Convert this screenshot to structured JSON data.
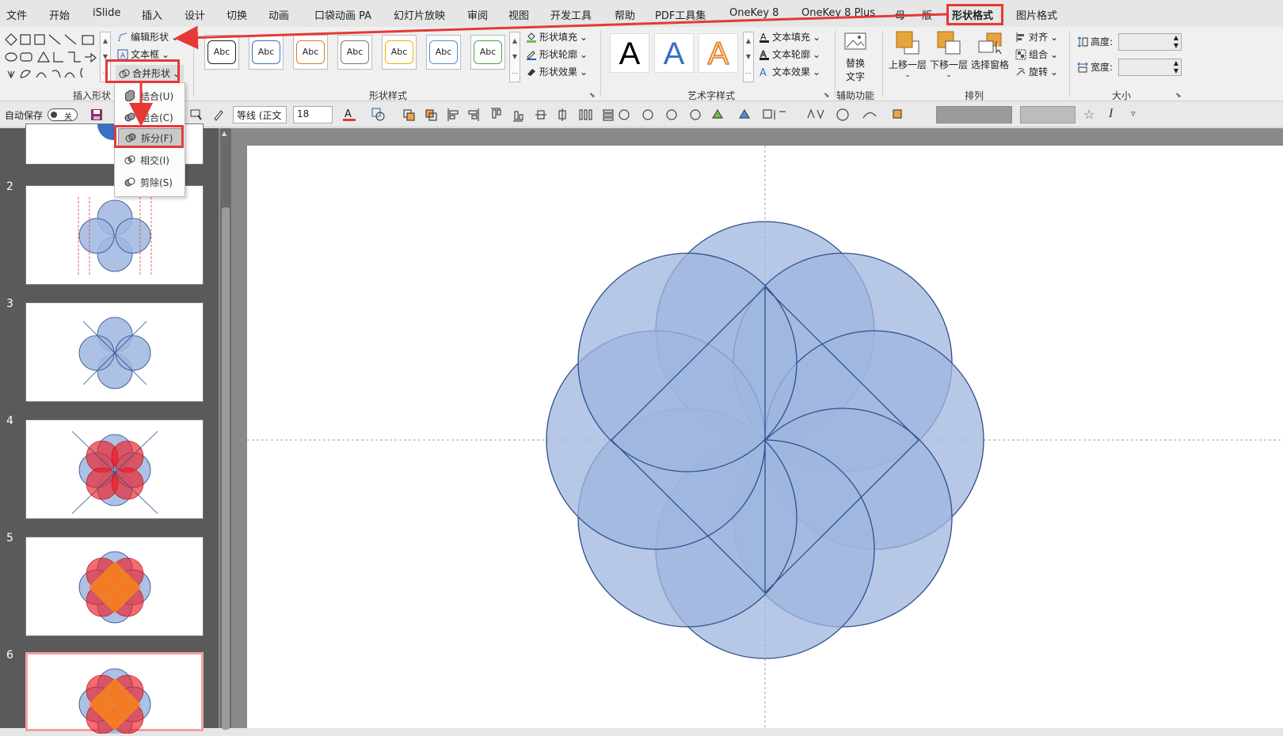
{
  "menubar": {
    "tabs": [
      "文件",
      "开始",
      "iSlide",
      "插入",
      "设计",
      "切换",
      "动画",
      "口袋动画 PA",
      "幻灯片放映",
      "审阅",
      "视图",
      "开发工具",
      "帮助",
      "PDF工具集",
      "OneKey 8",
      "OneKey 8 Plus",
      "母",
      "版",
      "形状格式",
      "图片格式"
    ],
    "active_tab": "形状格式"
  },
  "ribbon": {
    "insert_shapes": {
      "label": "插入形状",
      "edit_shape": "编辑形状",
      "text_box": "文本框",
      "merge_shapes": "合并形状"
    },
    "shape_styles": {
      "label": "形状样式",
      "preset_text": "Abc",
      "fill": "形状填充",
      "outline": "形状轮廓",
      "effects": "形状效果"
    },
    "wordart": {
      "label": "艺术字样式",
      "sample": "A",
      "text_fill": "文本填充",
      "text_outline": "文本轮廓",
      "text_effects": "文本效果"
    },
    "accessibility": {
      "label": "辅助功能",
      "alt_text_line1": "替换",
      "alt_text_line2": "文字"
    },
    "arrange": {
      "label": "排列",
      "bring_forward": "上移一层",
      "send_backward": "下移一层",
      "selection_pane": "选择窗格",
      "align": "对齐",
      "group": "组合",
      "rotate": "旋转"
    },
    "size": {
      "label": "大小",
      "height": "高度:",
      "width": "宽度:"
    }
  },
  "merge_menu": {
    "items": [
      "结合(U)",
      "组合(C)",
      "拆分(F)",
      "相交(I)",
      "剪除(S)"
    ],
    "highlighted": "拆分(F)"
  },
  "qat": {
    "autosave_label": "自动保存",
    "autosave_state": "关",
    "font_name": "等线 (正文",
    "font_size": "18"
  },
  "thumbnails": {
    "numbers": [
      "2",
      "3",
      "4",
      "5",
      "6"
    ],
    "selected": "6"
  },
  "colors": {
    "accent_red": "#e53935",
    "shape_fill": "#9fb6df",
    "shape_stroke": "#2f4f8f"
  }
}
